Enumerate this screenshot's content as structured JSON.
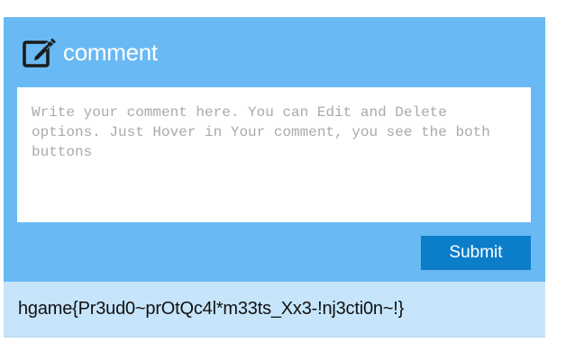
{
  "comment_box": {
    "title": "comment",
    "title_icon": "edit-icon",
    "textarea_placeholder": "Write your comment here. You can Edit and Delete options. Just Hover in Your comment, you see the both buttons",
    "textarea_value": "",
    "submit_label": "Submit"
  },
  "comments": [
    {
      "text": "hgame{Pr3ud0~prOtQc4l*m33ts_Xx3-!nj3cti0n~!}"
    }
  ],
  "colors": {
    "panel_bg": "#69b9f4",
    "button_bg": "#0c7dc9",
    "comment_bg": "#c6e5fb"
  }
}
